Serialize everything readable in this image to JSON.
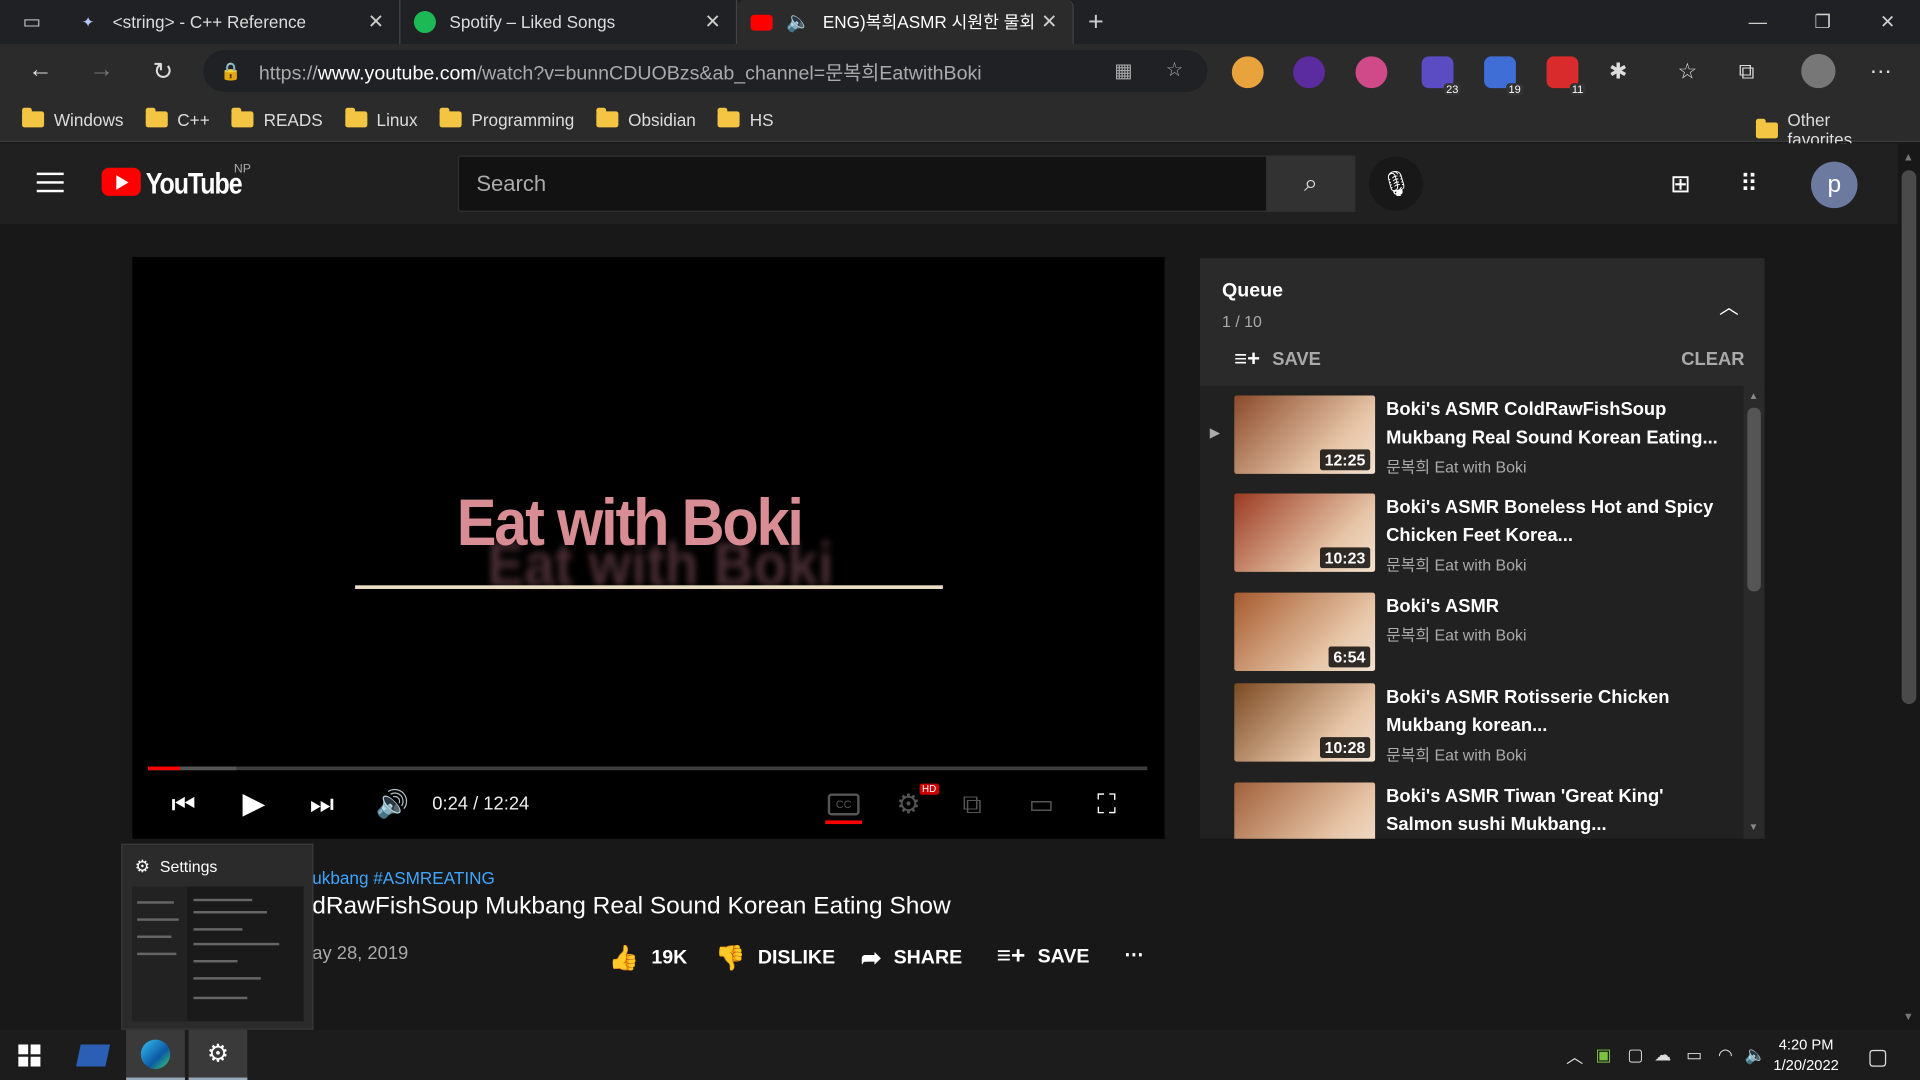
{
  "browser": {
    "tabs": [
      {
        "title": "<string> - C++ Reference",
        "favicon": "cpp-ref-icon",
        "active": false
      },
      {
        "title": "Spotify – Liked Songs",
        "favicon": "spotify-icon",
        "active": false
      },
      {
        "title": "ENG)복희ASMR 시원한 물회",
        "favicon": "youtube-icon",
        "active": true,
        "audio": true
      }
    ],
    "url_prefix": "https://",
    "url_domain": "www.youtube.com",
    "url_path": "/watch?v=bunnCDUOBzs&ab_channel=문복희EatwithBoki",
    "extensions": [
      {
        "name": "ext-orange-icon",
        "color": "#e8a33d",
        "count": ""
      },
      {
        "name": "ext-purple-icon",
        "color": "#5b2ca0",
        "count": ""
      },
      {
        "name": "ext-pink-icon",
        "color": "#d04a8a",
        "count": ""
      },
      {
        "name": "ext-blue-s-icon",
        "color": "#5b4cc4",
        "count": "23"
      },
      {
        "name": "ext-blue-hat-icon",
        "color": "#3f6fd6",
        "count": "19"
      },
      {
        "name": "ext-red-badge-icon",
        "color": "#d92b2b",
        "count": "11"
      }
    ],
    "bookmarks": [
      "Windows",
      "C++",
      "READS",
      "Linux",
      "Programming",
      "Obsidian",
      "HS"
    ],
    "other_favorites": "Other favorites"
  },
  "youtube": {
    "logo_text": "YouTube",
    "region": "NP",
    "search_placeholder": "Search",
    "avatar_letter": "p"
  },
  "player": {
    "title_card": "Eat with Boki",
    "current_time": "0:24",
    "duration": "12:24",
    "time_display": "0:24 / 12:24",
    "progress_fraction": 0.032,
    "hd_badge": "HD"
  },
  "video": {
    "hashtags": "ukbang #ASMREATING",
    "title": "dRawFishSoup Mukbang Real Sound Korean Eating Show",
    "date": "ay 28, 2019",
    "likes": "19K",
    "dislike_label": "DISLIKE",
    "share_label": "SHARE",
    "save_label": "SAVE"
  },
  "thumbnail_popup": {
    "title": "Settings"
  },
  "queue": {
    "title": "Queue",
    "count": "1 / 10",
    "save_label": "SAVE",
    "clear_label": "CLEAR",
    "items": [
      {
        "title": "Boki's ASMR ColdRawFishSoup Mukbang Real Sound Korean Eating...",
        "channel": "문복희 Eat with Boki",
        "duration": "12:25",
        "playing": true,
        "thumb_color": "#8a4a2a"
      },
      {
        "title": "Boki's ASMR Boneless Hot and Spicy Chicken Feet Korea...",
        "channel": "문복희 Eat with Boki",
        "duration": "10:23",
        "playing": false,
        "thumb_color": "#9b3a22"
      },
      {
        "title": "Boki's ASMR",
        "channel": "문복희 Eat with Boki",
        "duration": "6:54",
        "playing": false,
        "thumb_color": "#a65a2e"
      },
      {
        "title": "Boki's ASMR Rotisserie Chicken Mukbang korean...",
        "channel": "문복희 Eat with Boki",
        "duration": "10:28",
        "playing": false,
        "thumb_color": "#7c4a22"
      },
      {
        "title": "Boki's ASMR Tiwan 'Great King' Salmon sushi Mukbang...",
        "channel": "",
        "duration": "",
        "playing": false,
        "thumb_color": "#a0603a"
      }
    ]
  },
  "taskbar": {
    "time": "4:20 PM",
    "date": "1/20/2022"
  }
}
